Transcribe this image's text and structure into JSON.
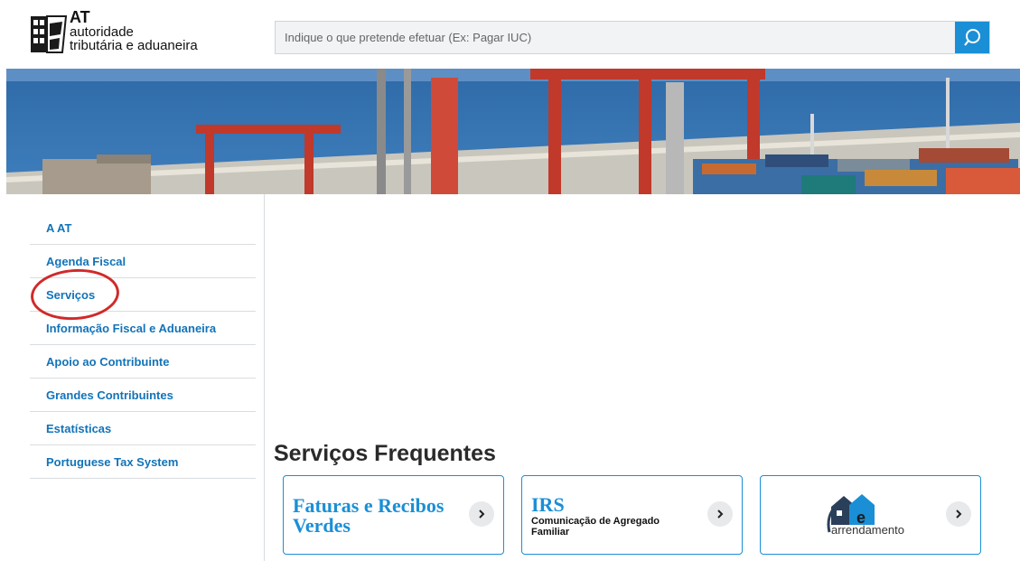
{
  "header": {
    "logo": {
      "line1": "AT",
      "line2": "autoridade",
      "line3": "tributária e aduaneira"
    },
    "search": {
      "placeholder": "Indique o que pretende efetuar (Ex: Pagar IUC)"
    },
    "search_icon": "search-icon",
    "brand_color": "#1a8fd6"
  },
  "sidebar": {
    "items": [
      {
        "label": "A AT"
      },
      {
        "label": "Agenda Fiscal"
      },
      {
        "label": "Serviços"
      },
      {
        "label": "Informação Fiscal e Aduaneira"
      },
      {
        "label": "Apoio ao Contribuinte"
      },
      {
        "label": "Grandes Contribuintes"
      },
      {
        "label": "Estatísticas"
      },
      {
        "label": "Portuguese Tax System"
      }
    ],
    "highlight_color": "#d02a2a"
  },
  "main": {
    "section_title": "Serviços Frequentes",
    "cards": [
      {
        "title": "Faturas e Recibos Verdes",
        "icon": "chevron-right-icon"
      },
      {
        "title": "IRS",
        "subtitle": "Comunicação de Agregado Familiar",
        "icon": "chevron-right-icon"
      },
      {
        "logo_text": "arrendamento",
        "logo_letter": "e",
        "icon": "chevron-right-icon"
      }
    ]
  }
}
